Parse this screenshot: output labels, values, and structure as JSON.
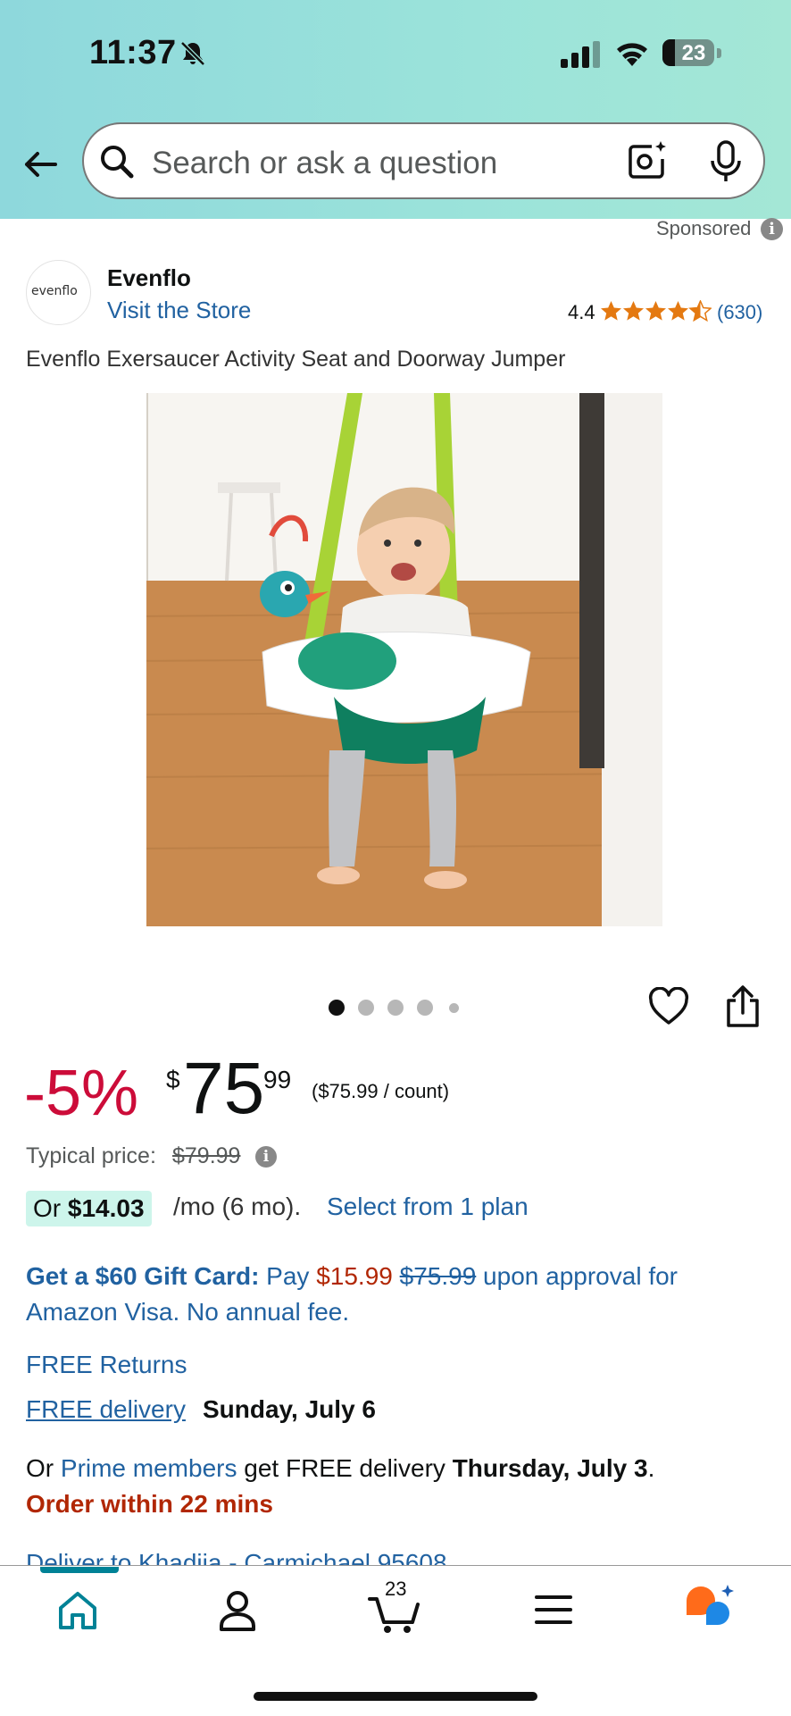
{
  "status_bar": {
    "time": "11:37",
    "battery": "23"
  },
  "search": {
    "placeholder": "Search or ask a question"
  },
  "sponsored_label": "Sponsored",
  "brand": {
    "logo_text": "evenflo",
    "name": "Evenflo",
    "visit_store": "Visit the Store"
  },
  "rating": {
    "value": "4.4",
    "stars_fraction": 0.88,
    "count": "(630)"
  },
  "product": {
    "title": "Evenflo Exersaucer Activity Seat and Doorway Jumper"
  },
  "carousel": {
    "dots": 5,
    "active_index": 0
  },
  "pricing": {
    "discount": "-5%",
    "currency_symbol": "$",
    "price_whole": "75",
    "price_fraction": "99",
    "unit_price": "($75.99 / count)",
    "typical_label": "Typical price:",
    "typical_price": "$79.99",
    "plan_prefix": "Or ",
    "plan_amount": "$14.03",
    "plan_suffix": "/mo (6 mo).",
    "plan_link": "Select from 1 plan"
  },
  "gift_card": {
    "bold": "Get a $60 Gift Card:",
    "pay": " Pay ",
    "red_price": "$15.99",
    "strike_price": "$75.99",
    "rest1": " upon approval for",
    "line2": "Amazon Visa. No annual fee."
  },
  "delivery": {
    "free_returns": "FREE Returns",
    "free_delivery": "FREE delivery",
    "delivery_date": "Sunday, July 6",
    "prime_prefix": "Or ",
    "prime_link": "Prime members",
    "prime_mid": " get FREE delivery ",
    "prime_date": "Thursday, July 3",
    "prime_end": ".",
    "order_within": "Order within 22 mins",
    "deliver_to": "Deliver to Khadija - Carmichael 95608"
  },
  "nav": {
    "cart_count": "23"
  },
  "colors": {
    "header": "#8ed8dc",
    "discount": "#cc0c39",
    "link": "#2162a1",
    "deal_red": "#b12704",
    "star": "#e47911",
    "badge": "#cdf5eb",
    "teal": "#008296"
  }
}
